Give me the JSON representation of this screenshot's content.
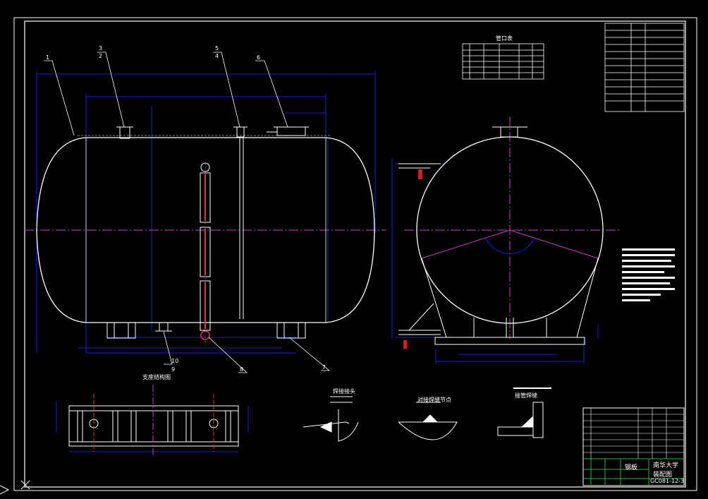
{
  "balloons": [
    "1",
    "3",
    "2",
    "5",
    "4",
    "6",
    "10",
    "9",
    "8",
    "7"
  ],
  "views": {
    "support_section_title": "支座结构图",
    "detail_a_title": "焊接接头",
    "detail_b_title": "对接焊缝节点",
    "detail_c_title": "接管焊缝"
  },
  "nozzle_table_title": "管口表",
  "title_block": {
    "material": "钢板",
    "school": "南华大学",
    "drawing_name": "装配图",
    "drawing_no": "GC081-12-3"
  },
  "colors": {
    "background": "#000000",
    "outline": "#ffffff",
    "dimension": "#1e1ed2",
    "centerline": "#c83cc8",
    "accent_red": "#ff2a2a",
    "title_green": "#2fb04a"
  }
}
